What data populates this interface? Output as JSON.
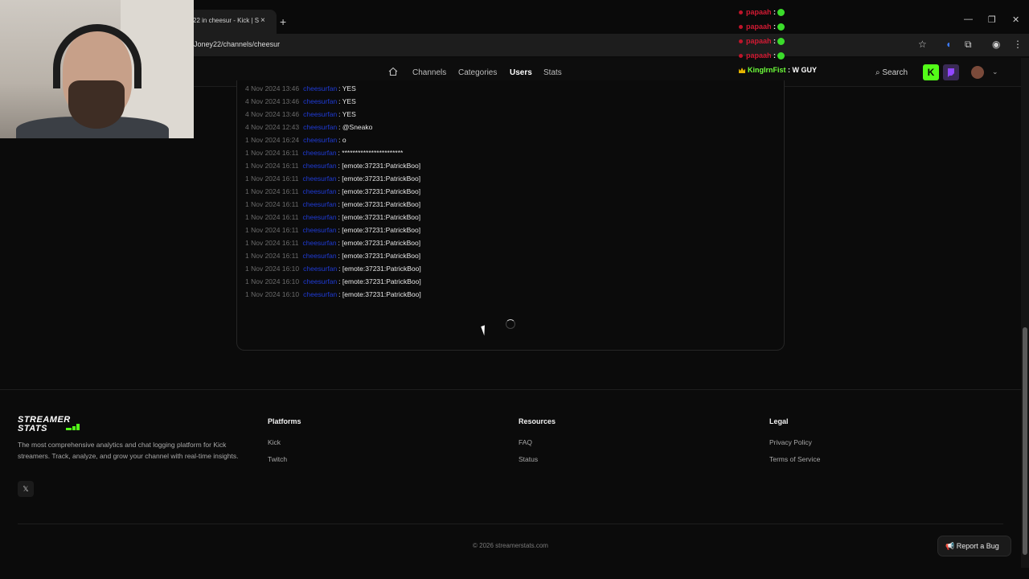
{
  "browser": {
    "tab_title": "22 in cheesur - Kick | S",
    "url": "Joney22/channels/cheesur",
    "close_glyph": "×",
    "new_tab_glyph": "+",
    "window_buttons": [
      "—",
      "❐",
      "✕"
    ]
  },
  "nav": {
    "links": [
      "Channels",
      "Categories",
      "Users",
      "Stats"
    ],
    "active": "Users",
    "search_label": "Search",
    "kick_glyph": "K"
  },
  "chat_log": {
    "rows": [
      {
        "ts": "4 Nov 2024 13:46",
        "user": "cheesurfan",
        "msg": ": YES"
      },
      {
        "ts": "4 Nov 2024 13:46",
        "user": "cheesurfan",
        "msg": ": YES"
      },
      {
        "ts": "4 Nov 2024 13:46",
        "user": "cheesurfan",
        "msg": ": YES"
      },
      {
        "ts": "4 Nov 2024 12:43",
        "user": "cheesurfan",
        "msg": ": @Sneako"
      },
      {
        "ts": "1 Nov 2024 16:24",
        "user": "cheesurfan",
        "msg": ": o"
      },
      {
        "ts": "1 Nov 2024 16:11",
        "user": "cheesurfan",
        "msg": ": ***********************"
      },
      {
        "ts": "1 Nov 2024 16:11",
        "user": "cheesurfan",
        "msg": ": [emote:37231:PatrickBoo]"
      },
      {
        "ts": "1 Nov 2024 16:11",
        "user": "cheesurfan",
        "msg": ": [emote:37231:PatrickBoo]"
      },
      {
        "ts": "1 Nov 2024 16:11",
        "user": "cheesurfan",
        "msg": ": [emote:37231:PatrickBoo]"
      },
      {
        "ts": "1 Nov 2024 16:11",
        "user": "cheesurfan",
        "msg": ": [emote:37231:PatrickBoo]"
      },
      {
        "ts": "1 Nov 2024 16:11",
        "user": "cheesurfan",
        "msg": ": [emote:37231:PatrickBoo]"
      },
      {
        "ts": "1 Nov 2024 16:11",
        "user": "cheesurfan",
        "msg": ": [emote:37231:PatrickBoo]"
      },
      {
        "ts": "1 Nov 2024 16:11",
        "user": "cheesurfan",
        "msg": ": [emote:37231:PatrickBoo]"
      },
      {
        "ts": "1 Nov 2024 16:11",
        "user": "cheesurfan",
        "msg": ": [emote:37231:PatrickBoo]"
      },
      {
        "ts": "1 Nov 2024 16:10",
        "user": "cheesurfan",
        "msg": ": [emote:37231:PatrickBoo]"
      },
      {
        "ts": "1 Nov 2024 16:10",
        "user": "cheesurfan",
        "msg": ": [emote:37231:PatrickBoo]"
      },
      {
        "ts": "1 Nov 2024 16:10",
        "user": "cheesurfan",
        "msg": ": [emote:37231:PatrickBoo]"
      }
    ]
  },
  "footer": {
    "logo_line1": "STREAMER",
    "logo_line2": "STATS",
    "description": "The most comprehensive analytics and chat logging platform for Kick streamers. Track, analyze, and grow your channel with real-time insights.",
    "x_glyph": "𝕏",
    "platforms": {
      "heading": "Platforms",
      "links": [
        "Kick",
        "Twitch"
      ]
    },
    "resources": {
      "heading": "Resources",
      "links": [
        "FAQ",
        "Status"
      ]
    },
    "legal": {
      "heading": "Legal",
      "links": [
        "Privacy Policy",
        "Terms of Service"
      ]
    },
    "copyright": "© 2026 streamerstats.com",
    "report_bug": "Report a Bug"
  },
  "stream_chat": {
    "lines": [
      {
        "name": "papaah",
        "sep": " :"
      },
      {
        "name": "papaah",
        "sep": " :"
      },
      {
        "name": "papaah",
        "sep": " :"
      },
      {
        "name": "papaah",
        "sep": " :"
      }
    ],
    "king": {
      "name": "KingIrnFist",
      "msg": " : W GUY"
    }
  },
  "colors": {
    "accent": "#53fc18",
    "username": "#1f3bd6",
    "chat_name": "#d11a33"
  }
}
